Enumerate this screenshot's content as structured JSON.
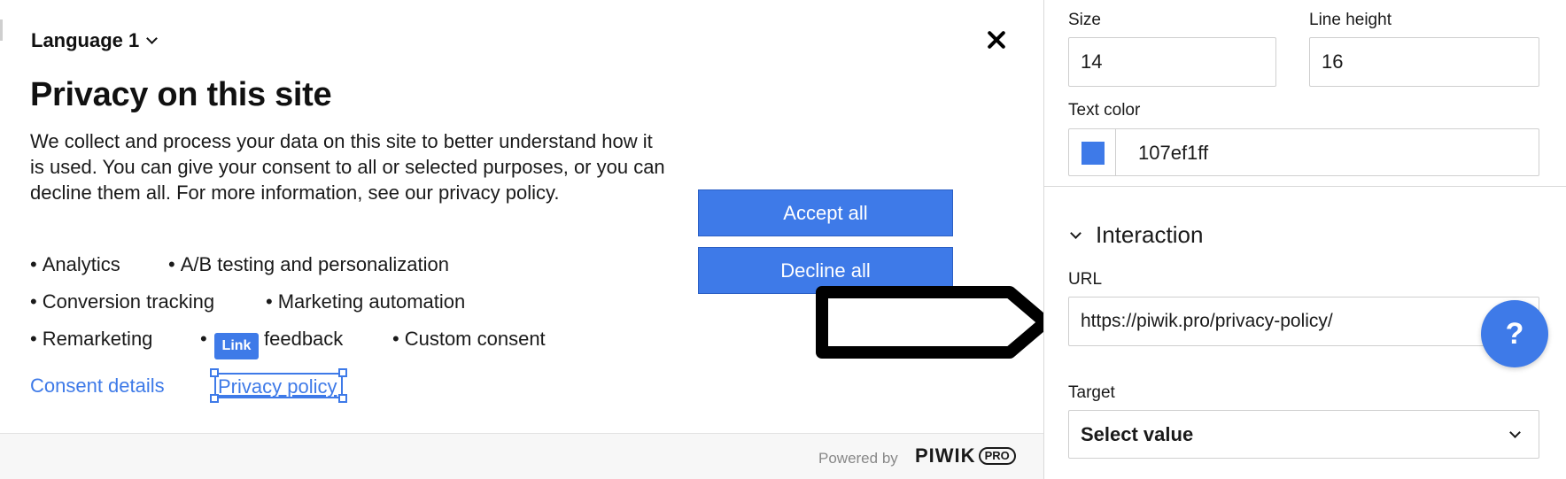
{
  "banner": {
    "language_label": "Language 1",
    "title": "Privacy on this site",
    "description": "We collect and process your data on this site to better understand how it is used. You can give your consent to all or selected purposes, or you can decline them all. For more information, see our privacy policy.",
    "bullet": "•",
    "purposes": [
      "Analytics",
      "A/B testing and personalization",
      "Conversion tracking",
      "Marketing automation",
      "Remarketing",
      "feedback",
      "Custom consent"
    ],
    "link_badge": "Link",
    "consent_details": "Consent details",
    "privacy_policy": "Privacy policy",
    "accept_all": "Accept all",
    "decline_all": "Decline all",
    "powered_by": "Powered by",
    "brand_name": "PIWIK",
    "brand_suffix": "PRO"
  },
  "panel": {
    "size_label": "Size",
    "size_value": "14",
    "line_height_label": "Line height",
    "line_height_value": "16",
    "text_color_label": "Text color",
    "text_color_value": "107ef1ff",
    "interaction_title": "Interaction",
    "url_label": "URL",
    "url_value": "https://piwik.pro/privacy-policy/",
    "target_label": "Target",
    "target_value": "Select value"
  },
  "help_label": "?",
  "colors": {
    "accent": "#3e7ae8",
    "text": "#1a1a1a",
    "border": "#cfcfcf"
  },
  "icons": [
    "chevron-down-icon",
    "close-icon",
    "help-icon",
    "arrow-annotation"
  ]
}
